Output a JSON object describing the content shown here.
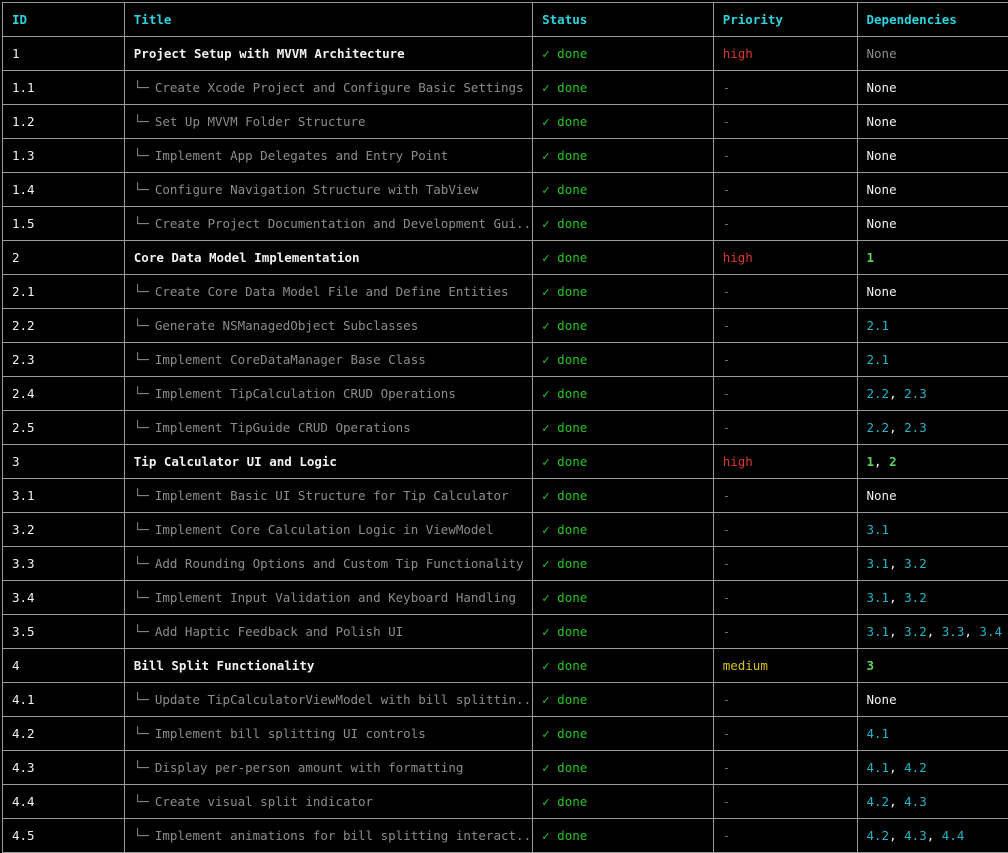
{
  "colors": {
    "background": "#000000",
    "header": "#2fd3e0",
    "status_done": "#23c623",
    "priority_high": "#d93a2b",
    "priority_medium": "#d6c21c",
    "dependency_subtask": "#24b3c8",
    "dependency_task": "#5fd35f",
    "border": "#9a9a9a"
  },
  "table": {
    "headers": [
      "ID",
      "Title",
      "Status",
      "Priority",
      "Dependencies"
    ],
    "tree_glyph": "└─",
    "rows": [
      {
        "id": "1",
        "title": "Project Setup with MVVM Architecture",
        "is_subtask": false,
        "status": "✓ done",
        "priority": "high",
        "dependencies": [],
        "dependencies_text": "None"
      },
      {
        "id": "1.1",
        "title": "Create Xcode Project and Configure Basic Settings",
        "is_subtask": true,
        "status": "✓ done",
        "priority": "-",
        "dependencies": [],
        "dependencies_text": "None"
      },
      {
        "id": "1.2",
        "title": "Set Up MVVM Folder Structure",
        "is_subtask": true,
        "status": "✓ done",
        "priority": "-",
        "dependencies": [],
        "dependencies_text": "None"
      },
      {
        "id": "1.3",
        "title": "Implement App Delegates and Entry Point",
        "is_subtask": true,
        "status": "✓ done",
        "priority": "-",
        "dependencies": [],
        "dependencies_text": "None"
      },
      {
        "id": "1.4",
        "title": "Configure Navigation Structure with TabView",
        "is_subtask": true,
        "status": "✓ done",
        "priority": "-",
        "dependencies": [],
        "dependencies_text": "None"
      },
      {
        "id": "1.5",
        "title": "Create Project Documentation and Development Gui...",
        "is_subtask": true,
        "status": "✓ done",
        "priority": "-",
        "dependencies": [],
        "dependencies_text": "None"
      },
      {
        "id": "2",
        "title": "Core Data Model Implementation",
        "is_subtask": false,
        "status": "✓ done",
        "priority": "high",
        "dependencies": [
          "1"
        ],
        "dependencies_text": ""
      },
      {
        "id": "2.1",
        "title": "Create Core Data Model File and Define Entities",
        "is_subtask": true,
        "status": "✓ done",
        "priority": "-",
        "dependencies": [],
        "dependencies_text": "None"
      },
      {
        "id": "2.2",
        "title": "Generate NSManagedObject Subclasses",
        "is_subtask": true,
        "status": "✓ done",
        "priority": "-",
        "dependencies": [
          "2.1"
        ],
        "dependencies_text": ""
      },
      {
        "id": "2.3",
        "title": "Implement CoreDataManager Base Class",
        "is_subtask": true,
        "status": "✓ done",
        "priority": "-",
        "dependencies": [
          "2.1"
        ],
        "dependencies_text": ""
      },
      {
        "id": "2.4",
        "title": "Implement TipCalculation CRUD Operations",
        "is_subtask": true,
        "status": "✓ done",
        "priority": "-",
        "dependencies": [
          "2.2",
          "2.3"
        ],
        "dependencies_text": ""
      },
      {
        "id": "2.5",
        "title": "Implement TipGuide CRUD Operations",
        "is_subtask": true,
        "status": "✓ done",
        "priority": "-",
        "dependencies": [
          "2.2",
          "2.3"
        ],
        "dependencies_text": ""
      },
      {
        "id": "3",
        "title": "Tip Calculator UI and Logic",
        "is_subtask": false,
        "status": "✓ done",
        "priority": "high",
        "dependencies": [
          "1",
          "2"
        ],
        "dependencies_text": ""
      },
      {
        "id": "3.1",
        "title": "Implement Basic UI Structure for Tip Calculator",
        "is_subtask": true,
        "status": "✓ done",
        "priority": "-",
        "dependencies": [],
        "dependencies_text": "None"
      },
      {
        "id": "3.2",
        "title": "Implement Core Calculation Logic in ViewModel",
        "is_subtask": true,
        "status": "✓ done",
        "priority": "-",
        "dependencies": [
          "3.1"
        ],
        "dependencies_text": ""
      },
      {
        "id": "3.3",
        "title": "Add Rounding Options and Custom Tip Functionality",
        "is_subtask": true,
        "status": "✓ done",
        "priority": "-",
        "dependencies": [
          "3.1",
          "3.2"
        ],
        "dependencies_text": ""
      },
      {
        "id": "3.4",
        "title": "Implement Input Validation and Keyboard Handling",
        "is_subtask": true,
        "status": "✓ done",
        "priority": "-",
        "dependencies": [
          "3.1",
          "3.2"
        ],
        "dependencies_text": ""
      },
      {
        "id": "3.5",
        "title": "Add Haptic Feedback and Polish UI",
        "is_subtask": true,
        "status": "✓ done",
        "priority": "-",
        "dependencies": [
          "3.1",
          "3.2",
          "3.3",
          "3.4"
        ],
        "dependencies_text": ""
      },
      {
        "id": "4",
        "title": "Bill Split Functionality",
        "is_subtask": false,
        "status": "✓ done",
        "priority": "medium",
        "dependencies": [
          "3"
        ],
        "dependencies_text": ""
      },
      {
        "id": "4.1",
        "title": "Update TipCalculatorViewModel with bill splittin...",
        "is_subtask": true,
        "status": "✓ done",
        "priority": "-",
        "dependencies": [],
        "dependencies_text": "None"
      },
      {
        "id": "4.2",
        "title": "Implement bill splitting UI controls",
        "is_subtask": true,
        "status": "✓ done",
        "priority": "-",
        "dependencies": [
          "4.1"
        ],
        "dependencies_text": ""
      },
      {
        "id": "4.3",
        "title": "Display per-person amount with formatting",
        "is_subtask": true,
        "status": "✓ done",
        "priority": "-",
        "dependencies": [
          "4.1",
          "4.2"
        ],
        "dependencies_text": ""
      },
      {
        "id": "4.4",
        "title": "Create visual split indicator",
        "is_subtask": true,
        "status": "✓ done",
        "priority": "-",
        "dependencies": [
          "4.2",
          "4.3"
        ],
        "dependencies_text": ""
      },
      {
        "id": "4.5",
        "title": "Implement animations for bill splitting interact...",
        "is_subtask": true,
        "status": "✓ done",
        "priority": "-",
        "dependencies": [
          "4.2",
          "4.3",
          "4.4"
        ],
        "dependencies_text": ""
      }
    ]
  }
}
